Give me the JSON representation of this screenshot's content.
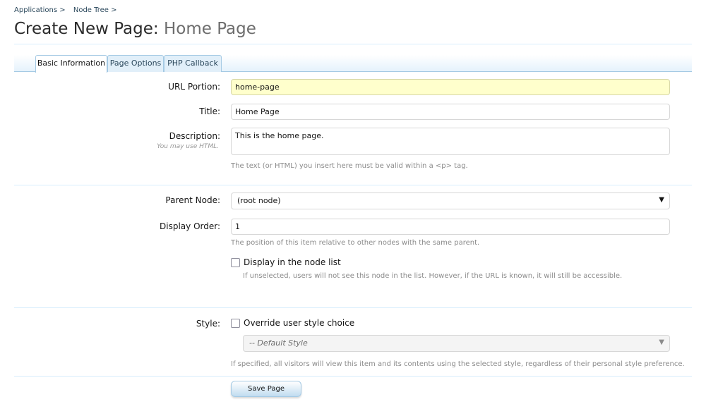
{
  "breadcrumb": {
    "items": [
      "Applications >",
      "Node Tree >"
    ]
  },
  "title": {
    "main": "Create New Page:",
    "sub": "Home Page"
  },
  "tabs": [
    {
      "label": "Basic Information",
      "active": true
    },
    {
      "label": "Page Options",
      "active": false
    },
    {
      "label": "PHP Callback",
      "active": false
    }
  ],
  "form": {
    "url_portion": {
      "label": "URL Portion:",
      "value": "home-page"
    },
    "title": {
      "label": "Title:",
      "value": "Home Page"
    },
    "description": {
      "label": "Description:",
      "hint": "You may use HTML.",
      "value": "This is the home page.",
      "explain": "The text (or HTML) you insert here must be valid within a <p> tag."
    },
    "parent_node": {
      "label": "Parent Node:",
      "selected": "(root node)"
    },
    "display_order": {
      "label": "Display Order:",
      "value": "1",
      "explain": "The position of this item relative to other nodes with the same parent."
    },
    "display_in_list": {
      "label": "Display in the node list",
      "checked": false,
      "explain": "If unselected, users will not see this node in the list. However, if the URL is known, it will still be accessible."
    },
    "style": {
      "label": "Style:",
      "override_label": "Override user style choice",
      "checked": false,
      "selected": "-- Default Style",
      "explain": "If specified, all visitors will view this item and its contents using the selected style, regardless of their personal style preference."
    }
  },
  "actions": {
    "save_label": "Save Page"
  },
  "colors": {
    "accent": "#a5cae4",
    "link": "#2b485c",
    "highlight_field": "#ffffcc"
  }
}
